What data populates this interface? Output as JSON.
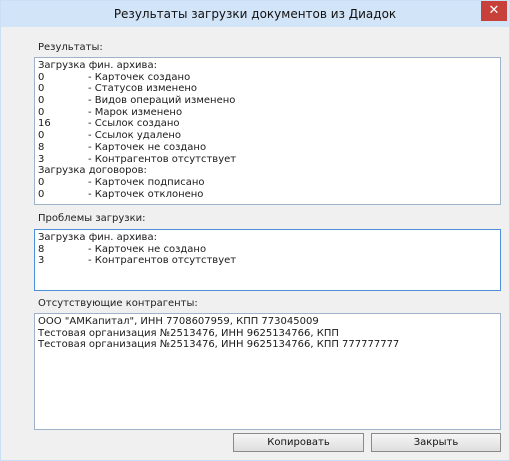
{
  "window": {
    "title": "Результаты загрузки документов из Диадок",
    "close_glyph": "✕"
  },
  "results": {
    "label": "Результаты:",
    "rows": [
      {
        "type": "head",
        "text": "Загрузка фин. архива:"
      },
      {
        "num": "0",
        "text": "- Карточек создано"
      },
      {
        "num": "0",
        "text": "- Статусов изменено"
      },
      {
        "num": "0",
        "text": "- Видов операций изменено"
      },
      {
        "num": "0",
        "text": "- Марок изменено"
      },
      {
        "num": "16",
        "text": "- Ссылок создано"
      },
      {
        "num": "0",
        "text": "- Ссылок удалено"
      },
      {
        "num": "8",
        "text": "- Карточек не создано"
      },
      {
        "num": "3",
        "text": "- Контрагентов отсутствует"
      },
      {
        "type": "head",
        "text": "Загрузка договоров:"
      },
      {
        "num": "0",
        "text": "- Карточек подписано"
      },
      {
        "num": "0",
        "text": "- Карточек отклонено"
      }
    ]
  },
  "problems": {
    "label": "Проблемы загрузки:",
    "rows": [
      {
        "type": "head",
        "text": "Загрузка фин. архива:"
      },
      {
        "num": "8",
        "text": "- Карточек не создано"
      },
      {
        "num": "3",
        "text": "- Контрагентов отсутствует"
      }
    ]
  },
  "missing": {
    "label": "Отсутствующие контрагенты:",
    "lines": [
      "ООО \"АМКапитал\", ИНН 7708607959, КПП 773045009",
      "Тестовая организация №2513476, ИНН 9625134766, КПП",
      "Тестовая организация №2513476, ИНН 9625134766, КПП 777777777"
    ]
  },
  "buttons": {
    "copy": "Копировать",
    "close": "Закрыть"
  }
}
